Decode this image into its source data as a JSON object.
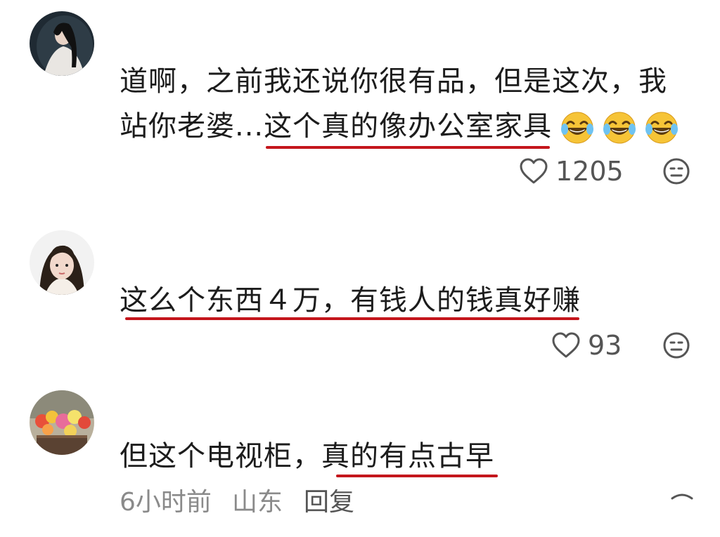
{
  "comments": [
    {
      "line1": "道啊，之前我还说你很有品，但是这次，我",
      "line2_plain": "站你老婆...",
      "line2_highlight": "这个真的像办公室家具",
      "emojis": [
        "laughing-tears-emoji",
        "laughing-tears-emoji",
        "laughing-tears-emoji"
      ],
      "likes": "1205"
    },
    {
      "line1_highlight": "这么个东西４万，有钱人的钱真好赚",
      "likes": "93"
    },
    {
      "line1_plain": "但这个电视柜，",
      "line1_highlight": "真的有点古早",
      "time": "6小时前",
      "location": "山东",
      "reply_label": "回复"
    }
  ],
  "colors": {
    "underline": "#c4161c",
    "text": "#1c1c1c",
    "meta": "#8a8a8a"
  }
}
